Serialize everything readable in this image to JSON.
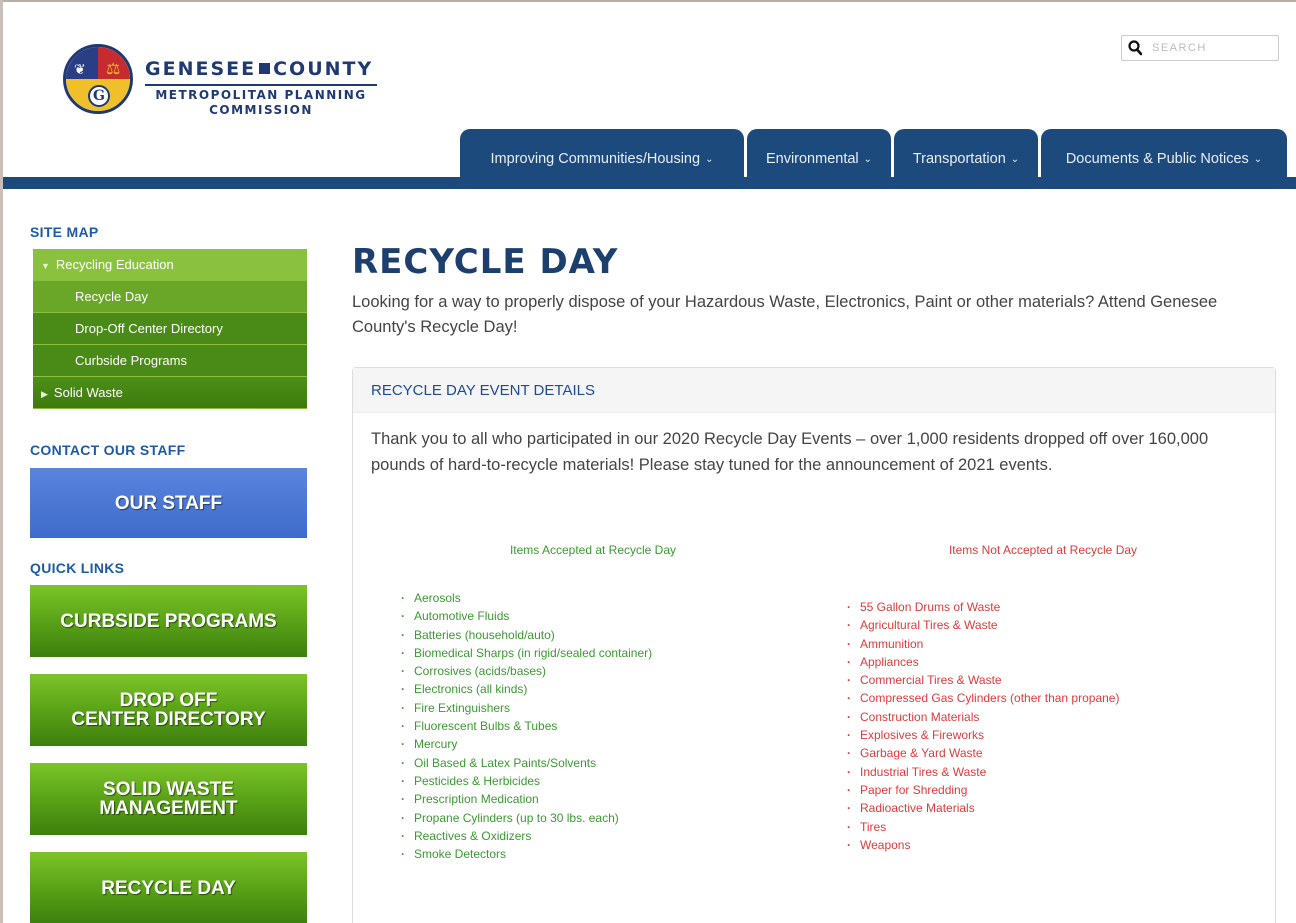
{
  "header": {
    "logo": {
      "title_left": "GENESEE",
      "title_right": "COUNTY",
      "subtitle_1": "METROPOLITAN PLANNING",
      "subtitle_2": "COMMISSION",
      "seal_letter": "G"
    },
    "search": {
      "placeholder": "SEARCH",
      "value": ""
    },
    "nav": [
      {
        "label": "Improving Communities/Housing"
      },
      {
        "label": "Environmental"
      },
      {
        "label": "Transportation"
      },
      {
        "label": "Documents & Public Notices"
      }
    ]
  },
  "sidebar": {
    "site_map_heading": "SITE MAP",
    "site_map": [
      {
        "label": "Recycling Education"
      },
      {
        "label": "Recycle Day"
      },
      {
        "label": "Drop-Off Center Directory"
      },
      {
        "label": "Curbside Programs"
      },
      {
        "label": "Solid Waste"
      }
    ],
    "contact_heading": "CONTACT OUR STAFF",
    "staff_button": "OUR STAFF",
    "quick_links_heading": "QUICK LINKS",
    "quick_links": [
      {
        "label": "CURBSIDE PROGRAMS"
      },
      {
        "label": "DROP OFF\nCENTER DIRECTORY"
      },
      {
        "label": "SOLID WASTE\nMANAGEMENT"
      },
      {
        "label": "RECYCLE DAY"
      }
    ]
  },
  "main": {
    "title": "RECYCLE DAY",
    "intro": "Looking for a way to properly dispose of your Hazardous Waste, Electronics, Paint or other materials? Attend Genesee County's Recycle Day!",
    "panel": {
      "heading": "RECYCLE DAY EVENT DETAILS",
      "text": "Thank you to all who participated in our 2020 Recycle Day Events – over 1,000 residents dropped off over 160,000 pounds of hard-to-recycle materials! Please stay tuned for the announcement of 2021 events.",
      "accepted_heading": "Items Accepted at Recycle Day",
      "accepted": [
        "Aerosols",
        "Automotive Fluids",
        "Batteries (household/auto)",
        "Biomedical Sharps (in rigid/sealed container)",
        "Corrosives (acids/bases)",
        "Electronics (all kinds)",
        "Fire Extinguishers",
        "Fluorescent Bulbs & Tubes",
        "Mercury",
        "Oil Based & Latex Paints/Solvents",
        "Pesticides & Herbicides",
        "Prescription Medication",
        "Propane Cylinders (up to 30 lbs. each)",
        "Reactives & Oxidizers",
        "Smoke Detectors"
      ],
      "not_accepted_heading": "Items Not Accepted at Recycle Day",
      "not_accepted": [
        "55 Gallon Drums of Waste",
        "Agricultural Tires & Waste",
        "Ammunition",
        "Appliances",
        "Commercial Tires & Waste",
        "Compressed Gas Cylinders (other than propane)",
        "Construction Materials",
        "Explosives & Fireworks",
        "Garbage & Yard Waste",
        "Industrial Tires & Waste",
        "Paper for Shredding",
        "Radioactive Materials",
        "Tires",
        "Weapons"
      ]
    }
  },
  "colors": {
    "brand_navy": "#1d4a7d",
    "accepted_green": "#3b9a32",
    "rejected_red": "#e23a3a",
    "sidebar_green": "#5aa318",
    "staff_blue": "#4a76d4"
  }
}
